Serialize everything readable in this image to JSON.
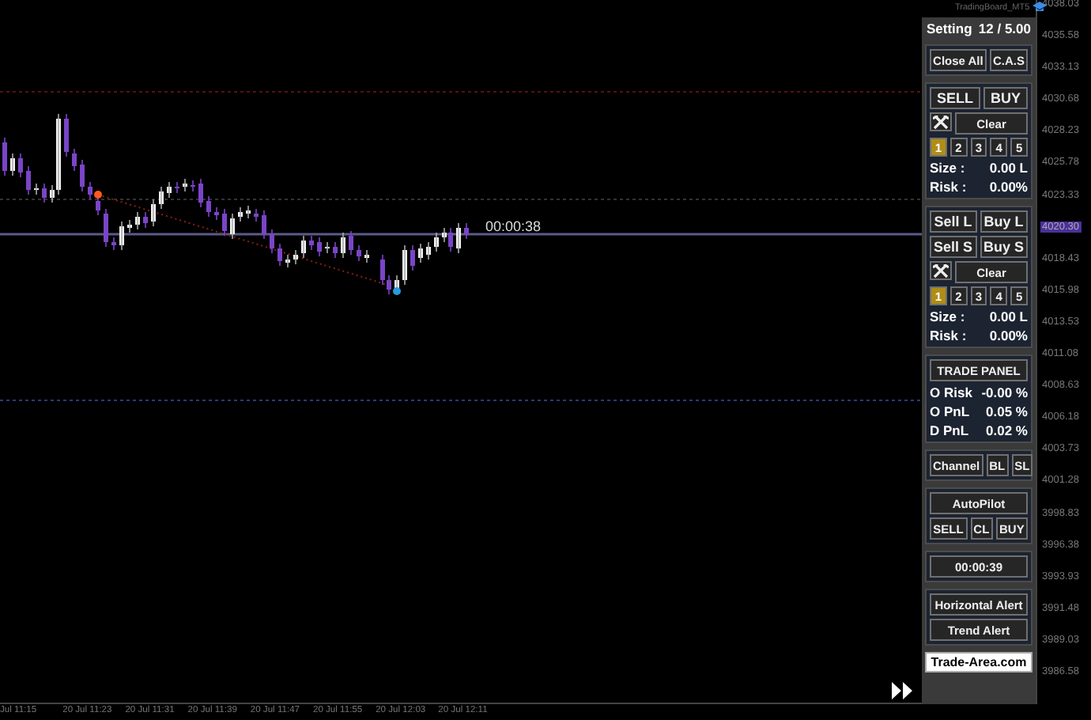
{
  "chart": {
    "countdown": "00:00:38",
    "price_labels": [
      {
        "text": "4038.03",
        "selected": false
      },
      {
        "text": "4035.58",
        "selected": false
      },
      {
        "text": "4033.13",
        "selected": false
      },
      {
        "text": "4030.68",
        "selected": false
      },
      {
        "text": "4028.23",
        "selected": false
      },
      {
        "text": "4025.78",
        "selected": false
      },
      {
        "text": "4023.33",
        "selected": false
      },
      {
        "text": "4020.30",
        "selected": true
      },
      {
        "text": "4018.43",
        "selected": false
      },
      {
        "text": "4015.98",
        "selected": false
      },
      {
        "text": "4013.53",
        "selected": false
      },
      {
        "text": "4011.08",
        "selected": false
      },
      {
        "text": "4008.63",
        "selected": false
      },
      {
        "text": "4006.18",
        "selected": false
      },
      {
        "text": "4003.73",
        "selected": false
      },
      {
        "text": "4001.28",
        "selected": false
      },
      {
        "text": "3998.83",
        "selected": false
      },
      {
        "text": "3996.38",
        "selected": false
      },
      {
        "text": "3993.93",
        "selected": false
      },
      {
        "text": "3991.48",
        "selected": false
      },
      {
        "text": "3989.03",
        "selected": false
      },
      {
        "text": "3986.58",
        "selected": false
      }
    ],
    "time_labels": [
      "Jul 11:15",
      "20 Jul 11:23",
      "20 Jul 11:31",
      "20 Jul 11:39",
      "20 Jul 11:47",
      "20 Jul 11:55",
      "20 Jul 12:03",
      "20 Jul 12:11"
    ]
  },
  "header": {
    "title": "TradingBoard_MT5"
  },
  "panel": {
    "setting_label": "Setting",
    "setting_value": "12 / 5.00",
    "top_buttons": [
      "Close All",
      "C.A.S"
    ],
    "trade_groups": [
      {
        "button_rows": [
          [
            "SELL",
            "BUY"
          ]
        ],
        "clear": "Clear",
        "presets": [
          {
            "label": "1",
            "selected": true
          },
          {
            "label": "2",
            "selected": false
          },
          {
            "label": "3",
            "selected": false
          },
          {
            "label": "4",
            "selected": false
          },
          {
            "label": "5",
            "selected": false
          }
        ],
        "size_label": "Size :",
        "size": "0.00 L",
        "risk_label": "Risk :",
        "risk": "0.00%"
      },
      {
        "button_rows": [
          [
            "Sell L",
            "Buy L"
          ],
          [
            "Sell S",
            "Buy S"
          ]
        ],
        "clear": "Clear",
        "presets": [
          {
            "label": "1",
            "selected": true
          },
          {
            "label": "2",
            "selected": false
          },
          {
            "label": "3",
            "selected": false
          },
          {
            "label": "4",
            "selected": false
          },
          {
            "label": "5",
            "selected": false
          }
        ],
        "size_label": "Size :",
        "size": "0.00 L",
        "risk_label": "Risk :",
        "risk": "0.00%"
      }
    ],
    "trade_panel": {
      "title": "TRADE PANEL",
      "rows": [
        {
          "label": "O Risk",
          "value": "-0.00 %"
        },
        {
          "label": "O PnL",
          "value": "0.05 %"
        },
        {
          "label": "D PnL",
          "value": "0.02 %"
        }
      ]
    },
    "channel_buttons": [
      "Channel",
      "BL",
      "SL"
    ],
    "autopilot": {
      "title": "AutoPilot",
      "buttons": [
        "SELL",
        "CL",
        "BUY"
      ]
    },
    "timer": "00:00:39",
    "alerts": [
      "Horizontal Alert",
      "Trend Alert"
    ],
    "brand": "Trade-Area.com"
  }
}
